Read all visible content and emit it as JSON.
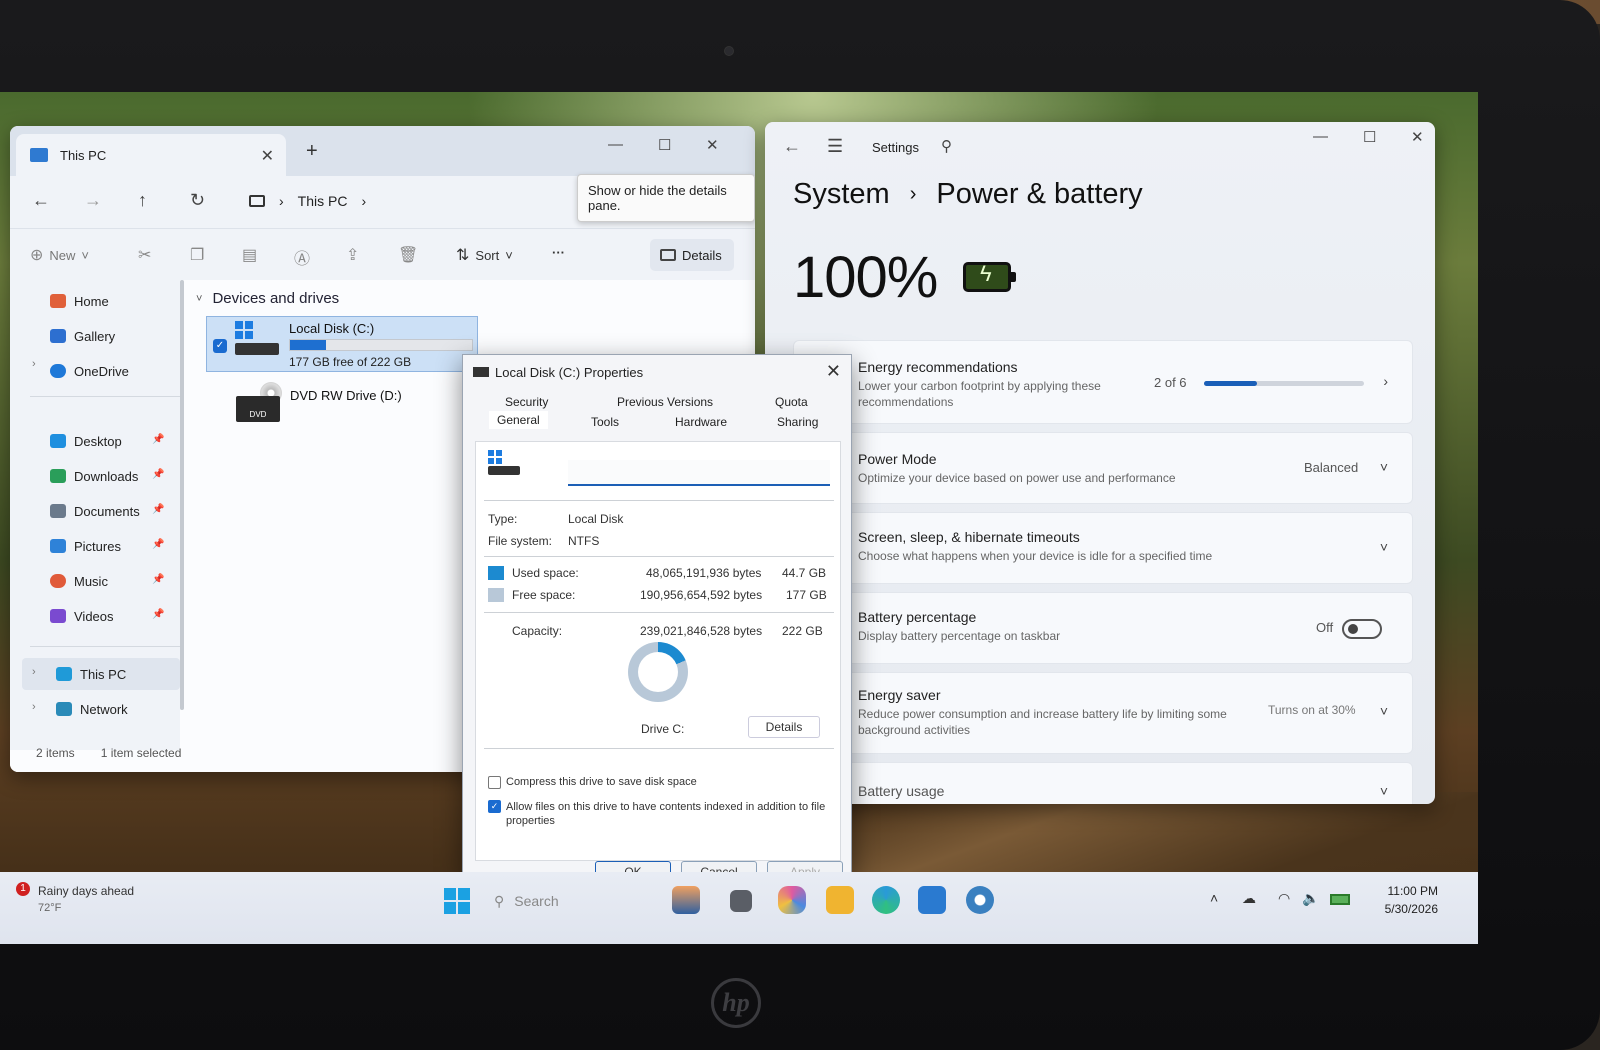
{
  "explorer": {
    "tab_title": "This PC",
    "address": "This PC",
    "tooltip": "Show or hide the details pane.",
    "toolbar": {
      "new_label": "New",
      "sort_label": "Sort",
      "more_label": "···",
      "details_label": "Details"
    },
    "sidebar": {
      "home": "Home",
      "gallery": "Gallery",
      "onedrive": "OneDrive",
      "desktop": "Desktop",
      "downloads": "Downloads",
      "documents": "Documents",
      "pictures": "Pictures",
      "music": "Music",
      "videos": "Videos",
      "this_pc": "This PC",
      "network": "Network"
    },
    "section_header": "Devices and drives",
    "drives": [
      {
        "name": "Local Disk (C:)",
        "free": "177 GB free of 222 GB",
        "used_fraction": 0.2
      },
      {
        "name": "DVD RW Drive (D:)",
        "badge": "DVD"
      }
    ],
    "status": {
      "items": "2 items",
      "selected": "1 item selected"
    }
  },
  "settings": {
    "app_title": "Settings",
    "breadcrumb": {
      "parent": "System",
      "sep": "›",
      "current": "Power & battery"
    },
    "battery_percent": "100%",
    "cards": {
      "energy_rec": {
        "title": "Energy recommendations",
        "sub": "Lower your carbon footprint by applying these recommendations",
        "progress_text": "2 of 6",
        "progress": 0.33
      },
      "power_mode": {
        "title": "Power Mode",
        "sub": "Optimize your device based on power use and performance",
        "value": "Balanced"
      },
      "screen_sleep": {
        "title": "Screen, sleep, & hibernate timeouts",
        "sub": "Choose what happens when your device is idle for a specified time"
      },
      "battery_pct": {
        "title": "Battery percentage",
        "sub": "Display battery percentage on taskbar",
        "value": "Off"
      },
      "energy_saver": {
        "title": "Energy saver",
        "sub": "Reduce power consumption and increase battery life by limiting some background activities",
        "value": "Turns on at 30%"
      },
      "battery_usage": {
        "title": "Battery usage"
      }
    }
  },
  "properties": {
    "title": "Local Disk (C:) Properties",
    "tabs_row1": [
      "Security",
      "Previous Versions",
      "Quota"
    ],
    "tabs_row2": [
      "General",
      "Tools",
      "Hardware",
      "Sharing"
    ],
    "type_label": "Type:",
    "type_value": "Local Disk",
    "fs_label": "File system:",
    "fs_value": "NTFS",
    "used_label": "Used space:",
    "used_bytes": "48,065,191,936 bytes",
    "used_gb": "44.7 GB",
    "free_label": "Free space:",
    "free_bytes": "190,956,654,592 bytes",
    "free_gb": "177 GB",
    "cap_label": "Capacity:",
    "cap_bytes": "239,021,846,528 bytes",
    "cap_gb": "222 GB",
    "drive_label": "Drive C:",
    "details_btn": "Details",
    "compress_label": "Compress this drive to save disk space",
    "index_label": "Allow files on this drive to have contents indexed in addition to file properties",
    "ok": "OK",
    "cancel": "Cancel",
    "apply": "Apply",
    "colors": {
      "used": "#1c8ad0",
      "free": "#b8c8d8"
    }
  },
  "taskbar": {
    "weather_badge": "1",
    "weather_title": "Rainy days ahead",
    "weather_temp": "72°F",
    "search_placeholder": "Search",
    "time": "11:00 PM",
    "date": "5/30/2026"
  }
}
